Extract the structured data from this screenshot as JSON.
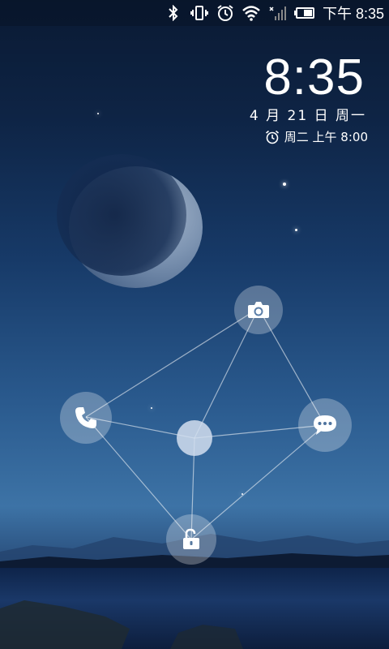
{
  "status_bar": {
    "icons": [
      "bluetooth-icon",
      "vibrate-icon",
      "alarm-icon",
      "wifi-icon",
      "signal-icon",
      "battery-icon"
    ],
    "time": "下午 8:35"
  },
  "lock": {
    "clock": "8:35",
    "date": "4 月 21 日 周一",
    "alarm": "周二 上午 8:00"
  },
  "unlock_targets": [
    {
      "name": "camera",
      "icon": "camera-icon"
    },
    {
      "name": "phone",
      "icon": "phone-icon"
    },
    {
      "name": "messages",
      "icon": "message-icon"
    },
    {
      "name": "unlock",
      "icon": "padlock-open-icon"
    }
  ],
  "colors": {
    "accent": "#ffffff",
    "sky_top": "#0a1a33",
    "sky_horizon": "#3d73a6"
  }
}
